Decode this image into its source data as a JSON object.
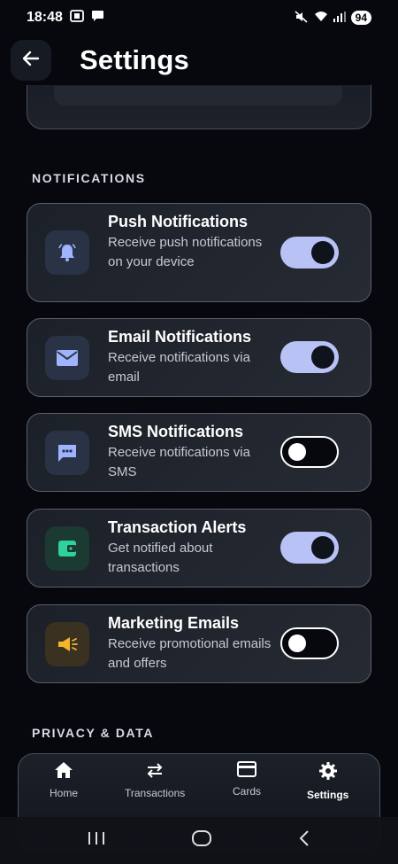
{
  "status_bar": {
    "time": "18:48",
    "battery": "94"
  },
  "header": {
    "title": "Settings"
  },
  "notifications_section": {
    "title": "NOTIFICATIONS"
  },
  "settings": [
    {
      "id": "push",
      "title": "Push Notifications",
      "description": "Receive push notifications on your device",
      "enabled": true,
      "icon": "bell-icon",
      "icon_bg": "#2a3346",
      "icon_color": "#9fb3ff"
    },
    {
      "id": "email",
      "title": "Email Notifications",
      "description": "Receive notifications via email",
      "enabled": true,
      "icon": "mail-icon",
      "icon_bg": "#2a3346",
      "icon_color": "#9fb3ff"
    },
    {
      "id": "sms",
      "title": "SMS Notifications",
      "description": "Receive notifications via SMS",
      "enabled": false,
      "icon": "chat-icon",
      "icon_bg": "#2a3346",
      "icon_color": "#9fb3ff"
    },
    {
      "id": "transactions",
      "title": "Transaction Alerts",
      "description": "Get notified about transactions",
      "enabled": true,
      "icon": "wallet-icon",
      "icon_bg": "#1a3a32",
      "icon_color": "#2fd29a"
    },
    {
      "id": "marketing",
      "title": "Marketing Emails",
      "description": "Receive promotional emails and offers",
      "enabled": false,
      "icon": "megaphone-icon",
      "icon_bg": "#3a3120",
      "icon_color": "#f5b62e"
    }
  ],
  "privacy_section": {
    "title": "PRIVACY & DATA"
  },
  "bottom_nav": {
    "items": [
      {
        "label": "Home",
        "icon": "home-icon",
        "active": false
      },
      {
        "label": "Transactions",
        "icon": "transfer-icon",
        "active": false
      },
      {
        "label": "Cards",
        "icon": "card-icon",
        "active": false
      },
      {
        "label": "Settings",
        "icon": "gear-icon",
        "active": true
      }
    ]
  },
  "colors": {
    "toggle_on": "#b8c2f5",
    "background": "#06080d",
    "card": "#1f232c"
  }
}
